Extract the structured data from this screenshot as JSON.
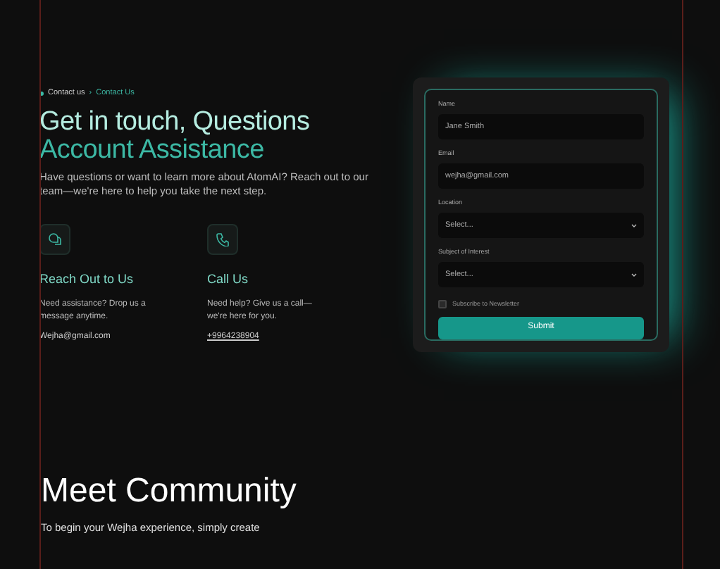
{
  "breadcrumb": {
    "items": [
      {
        "label": "Contact us",
        "selected": false
      },
      {
        "label": "Contact Us",
        "selected": true
      }
    ],
    "separator": "›"
  },
  "heading": {
    "line_1": "Get in touch, Questions",
    "line_2": "Account Assistance"
  },
  "intro": "Have questions or want to learn more about AtomAI? Reach out to our team—we're here to help you take the next step.",
  "contacts": [
    {
      "kind": "chat",
      "title": "Reach Out to Us",
      "text": "Need assistance? Drop us a message anytime.",
      "link": "Wejha@gmail.com"
    },
    {
      "kind": "phone",
      "title": "Call Us",
      "text": "Need help? Give us a call—we're here for you.",
      "link": "+9964238904"
    }
  ],
  "form": {
    "fields": [
      {
        "kind": "input",
        "label": "Name",
        "value": "Jane Smith"
      },
      {
        "kind": "input",
        "label": "Email",
        "value": "wejha@gmail.com"
      },
      {
        "kind": "select",
        "label": "Location",
        "value": "Select..."
      },
      {
        "kind": "select",
        "label": "Subject of Interest",
        "value": "Select..."
      }
    ],
    "newsletter": {
      "label": "Subscribe to Newsletter",
      "checked": false
    },
    "submit": "Submit"
  },
  "community": {
    "title": "Meet Community",
    "subtitle": "To begin your Wejha experience, simply create"
  }
}
